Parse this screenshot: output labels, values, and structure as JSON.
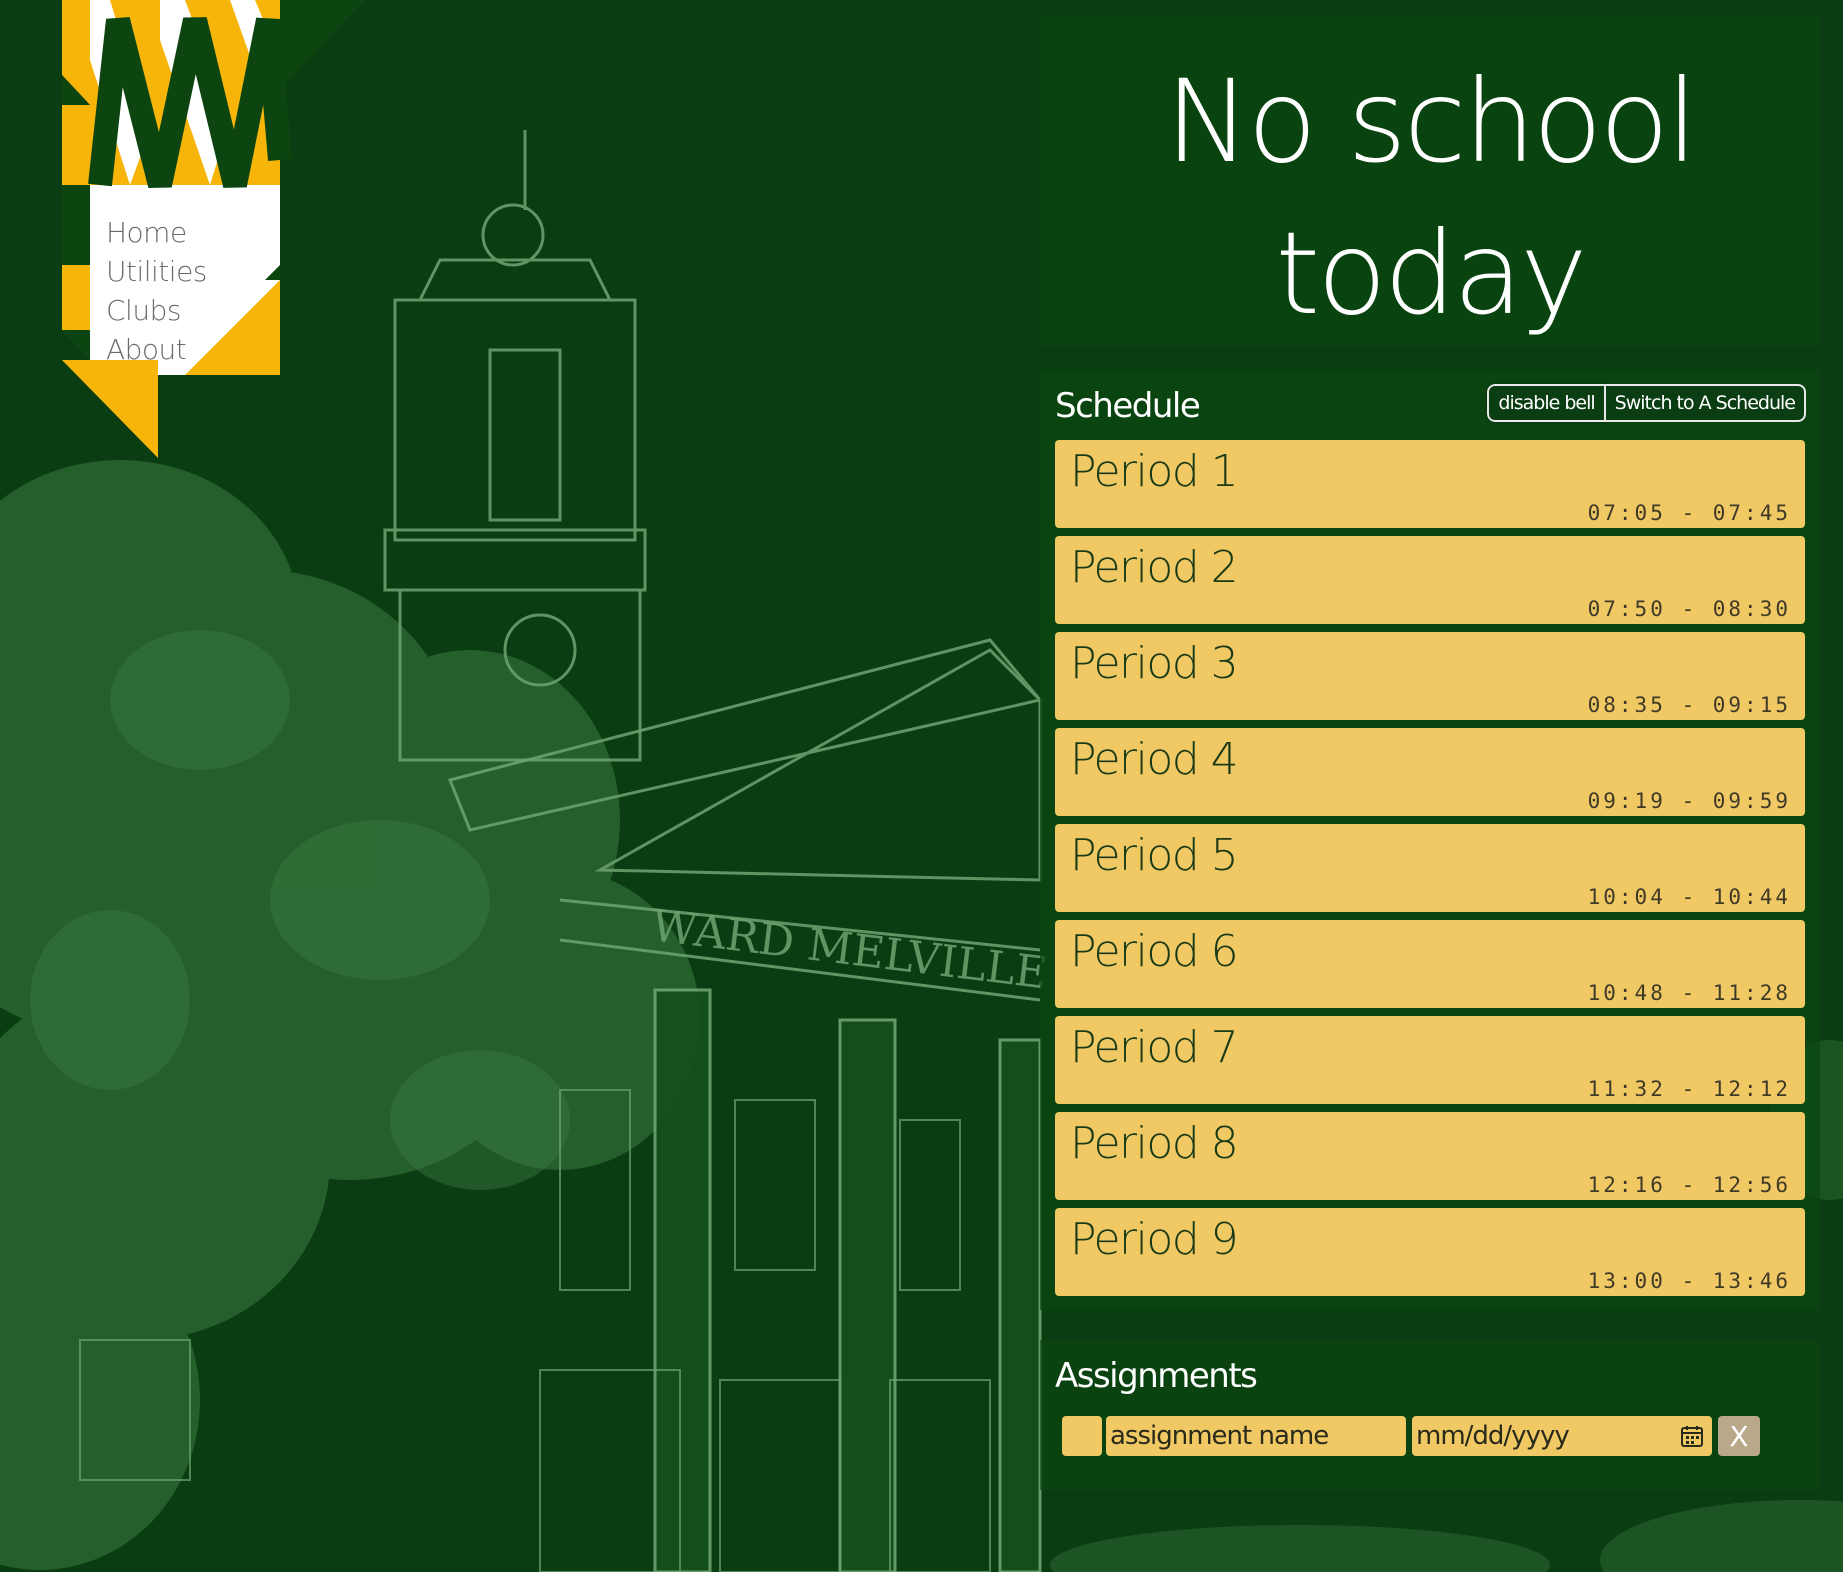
{
  "nav": {
    "items": [
      {
        "label": "Home"
      },
      {
        "label": "Utilities"
      },
      {
        "label": "Clubs"
      },
      {
        "label": "About"
      }
    ]
  },
  "status": {
    "message": "No school\ntoday"
  },
  "schedule": {
    "title": "Schedule",
    "disable_bell_label": "disable bell",
    "switch_label": "Switch to A Schedule",
    "periods": [
      {
        "name": "Period 1",
        "time": "07:05 - 07:45"
      },
      {
        "name": "Period 2",
        "time": "07:50 - 08:30"
      },
      {
        "name": "Period 3",
        "time": "08:35 - 09:15"
      },
      {
        "name": "Period 4",
        "time": "09:19 - 09:59"
      },
      {
        "name": "Period 5",
        "time": "10:04 - 10:44"
      },
      {
        "name": "Period 6",
        "time": "10:48 - 11:28"
      },
      {
        "name": "Period 7",
        "time": "11:32 - 12:12"
      },
      {
        "name": "Period 8",
        "time": "12:16 - 12:56"
      },
      {
        "name": "Period 9",
        "time": "13:00 - 13:46"
      }
    ]
  },
  "assignments": {
    "title": "Assignments",
    "name_placeholder": "assignment name",
    "date_placeholder": "mm/dd/yyyy",
    "delete_label": "X",
    "calendar_icon": "calendar-icon"
  },
  "background": {
    "sign_text": "WARD MELVILLE HI"
  },
  "colors": {
    "background": "#0b3d12",
    "accent_yellow": "#f0c964",
    "logo_yellow": "#f7b50a",
    "logo_green": "#0d4511"
  }
}
